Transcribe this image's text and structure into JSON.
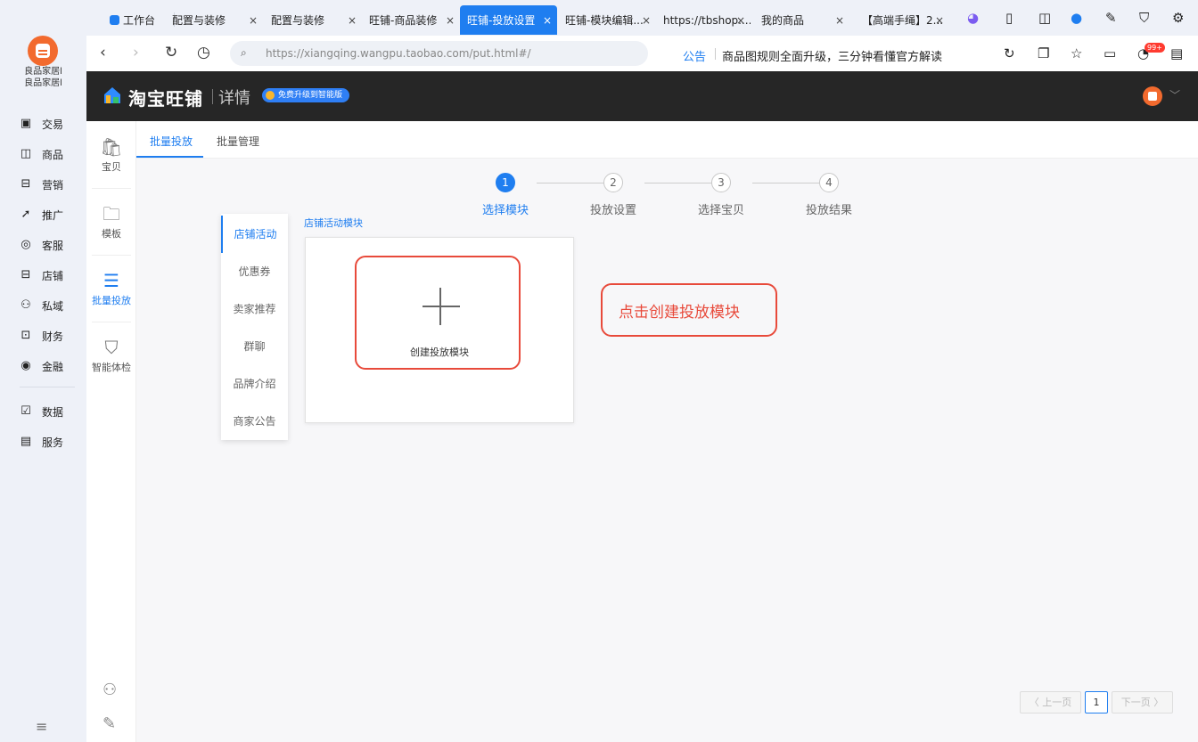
{
  "app": {
    "name_line1": "良品家居l",
    "name_line2": "良品家居l",
    "nav": [
      {
        "label": "交易",
        "icon": "▣"
      },
      {
        "label": "商品",
        "icon": "◫"
      },
      {
        "label": "营销",
        "icon": "⊟"
      },
      {
        "label": "推广",
        "icon": "➚"
      },
      {
        "label": "客服",
        "icon": "◎"
      },
      {
        "label": "店铺",
        "icon": "⊟"
      },
      {
        "label": "私域",
        "icon": "⚇"
      },
      {
        "label": "财务",
        "icon": "⊡"
      },
      {
        "label": "金融",
        "icon": "◉"
      },
      {
        "label": "数据",
        "icon": "☑"
      },
      {
        "label": "服务",
        "icon": "▤"
      }
    ]
  },
  "tabs": [
    {
      "label": "工作台",
      "active": false
    },
    {
      "label": "配置与装修",
      "active": false
    },
    {
      "label": "配置与装修",
      "active": false
    },
    {
      "label": "旺铺-商品装修",
      "active": false
    },
    {
      "label": "旺铺-投放设置",
      "active": true
    },
    {
      "label": "旺铺-模块编辑...",
      "active": false
    },
    {
      "label": "https://tbshop....",
      "active": false
    },
    {
      "label": "我的商品",
      "active": false
    },
    {
      "label": "【高端手绳】2...",
      "active": false
    }
  ],
  "navbar": {
    "url": "https://xiangqing.wangpu.taobao.com/put.html#/",
    "notice_label": "公告",
    "notice_text": "商品图规则全面升级，三分钟看懂官方解读",
    "badge": "99+"
  },
  "header": {
    "brand": "淘宝旺铺",
    "sub": "详情",
    "upgrade": "免费升级到智能版"
  },
  "subnav": [
    {
      "label": "宝贝",
      "icon": "🛍",
      "active": false
    },
    {
      "label": "模板",
      "icon": "🗀",
      "active": false
    },
    {
      "label": "批量投放",
      "icon": "☰",
      "active": true
    },
    {
      "label": "智能体检",
      "icon": "⛉",
      "active": false
    }
  ],
  "main": {
    "tabs": [
      {
        "label": "批量投放",
        "active": true
      },
      {
        "label": "批量管理",
        "active": false
      }
    ],
    "steps": [
      {
        "num": "1",
        "label": "选择模块",
        "active": true
      },
      {
        "num": "2",
        "label": "投放设置",
        "active": false
      },
      {
        "num": "3",
        "label": "选择宝贝",
        "active": false
      },
      {
        "num": "4",
        "label": "投放结果",
        "active": false
      }
    ],
    "categories": [
      "店铺活动",
      "优惠券",
      "卖家推荐",
      "群聊",
      "品牌介绍",
      "商家公告"
    ],
    "module_title": "店铺活动模块",
    "create_label": "创建投放模块",
    "callout": "点击创建投放模块",
    "pager": {
      "prev": "〈 上一页",
      "page": "1",
      "next": "下一页 〉"
    }
  },
  "colors": {
    "accent": "#1f7ef0",
    "annotation": "#e84a3b",
    "header_bg": "#262626"
  }
}
